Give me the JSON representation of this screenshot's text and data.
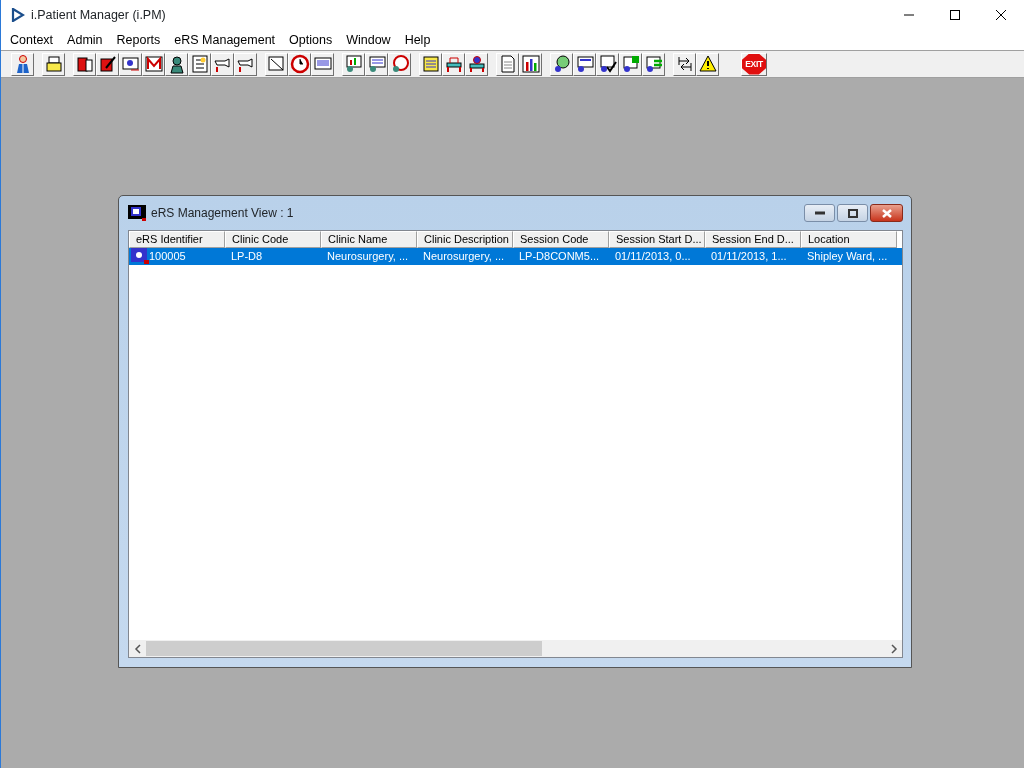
{
  "window": {
    "title": "i.Patient Manager (i.PM)"
  },
  "menu": [
    "Context",
    "Admin",
    "Reports",
    "eRS Management",
    "Options",
    "Window",
    "Help"
  ],
  "toolbar": {
    "exit_label": "EXIT"
  },
  "child_window": {
    "title": "eRS Management View : 1",
    "columns": [
      "eRS Identifier",
      "Clinic Code",
      "Clinic Name",
      "Clinic Description",
      "Session Code",
      "Session Start D...",
      "Session End D...",
      "Location"
    ],
    "rows": [
      {
        "selected": true,
        "cells": [
          "100005",
          "LP-D8",
          "Neurosurgery, ...",
          "Neurosurgery, ...",
          "LP-D8CONM5...",
          "01/11/2013, 0...",
          "01/11/2013, 1...",
          "Shipley Ward, ..."
        ]
      }
    ]
  }
}
